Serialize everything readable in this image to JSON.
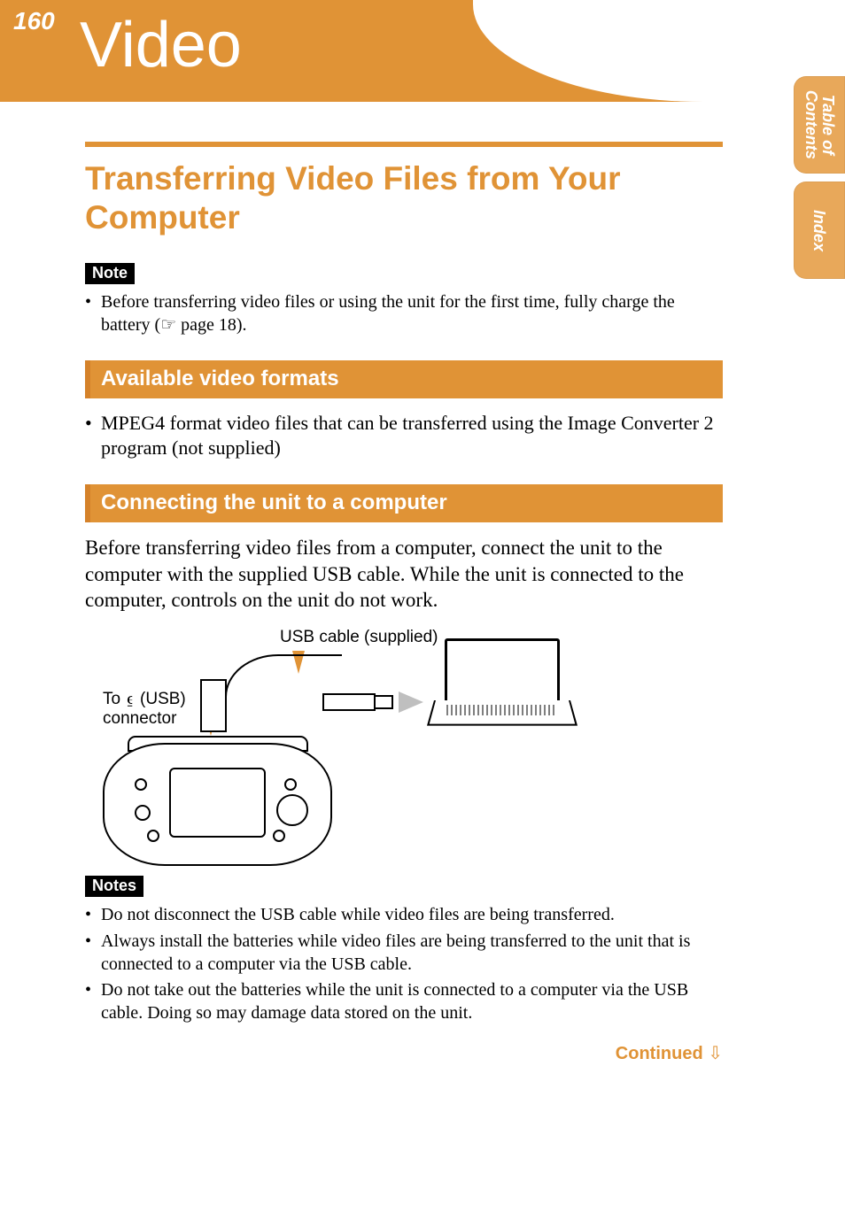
{
  "header": {
    "page_number": "160",
    "section_title": "Video"
  },
  "side_tabs": {
    "toc": "Table of\nContents",
    "index": "Index"
  },
  "main": {
    "h1": "Transferring Video Files from Your Computer",
    "note_label": "Note",
    "note_items": [
      "Before transferring video files or using the unit for the first time, fully charge the battery (☞ page 18)."
    ],
    "sections": [
      {
        "heading": "Available video formats",
        "bullets": [
          "MPEG4 format video files that can be transferred using the Image Converter 2 program (not supplied)"
        ]
      },
      {
        "heading": "Connecting the unit to a computer",
        "body": "Before transferring video files from a computer, connect the unit to the computer with the supplied USB cable. While the unit is connected to the computer, controls on the unit do not work."
      }
    ],
    "diagram": {
      "usb_cable_label": "USB cable (supplied)",
      "connector_label": "To ⍷ (USB)\nconnector"
    },
    "notes2_label": "Notes",
    "notes2_items": [
      "Do not disconnect the USB cable while video files are being transferred.",
      "Always install the batteries while video files are being transferred to the unit that is connected to a computer via the USB cable.",
      "Do not take out the batteries while the unit is connected to a computer via the USB cable. Doing so may damage data stored on the unit."
    ],
    "continued": "Continued",
    "continued_glyph": "⇩"
  },
  "colors": {
    "accent": "#e09336"
  }
}
